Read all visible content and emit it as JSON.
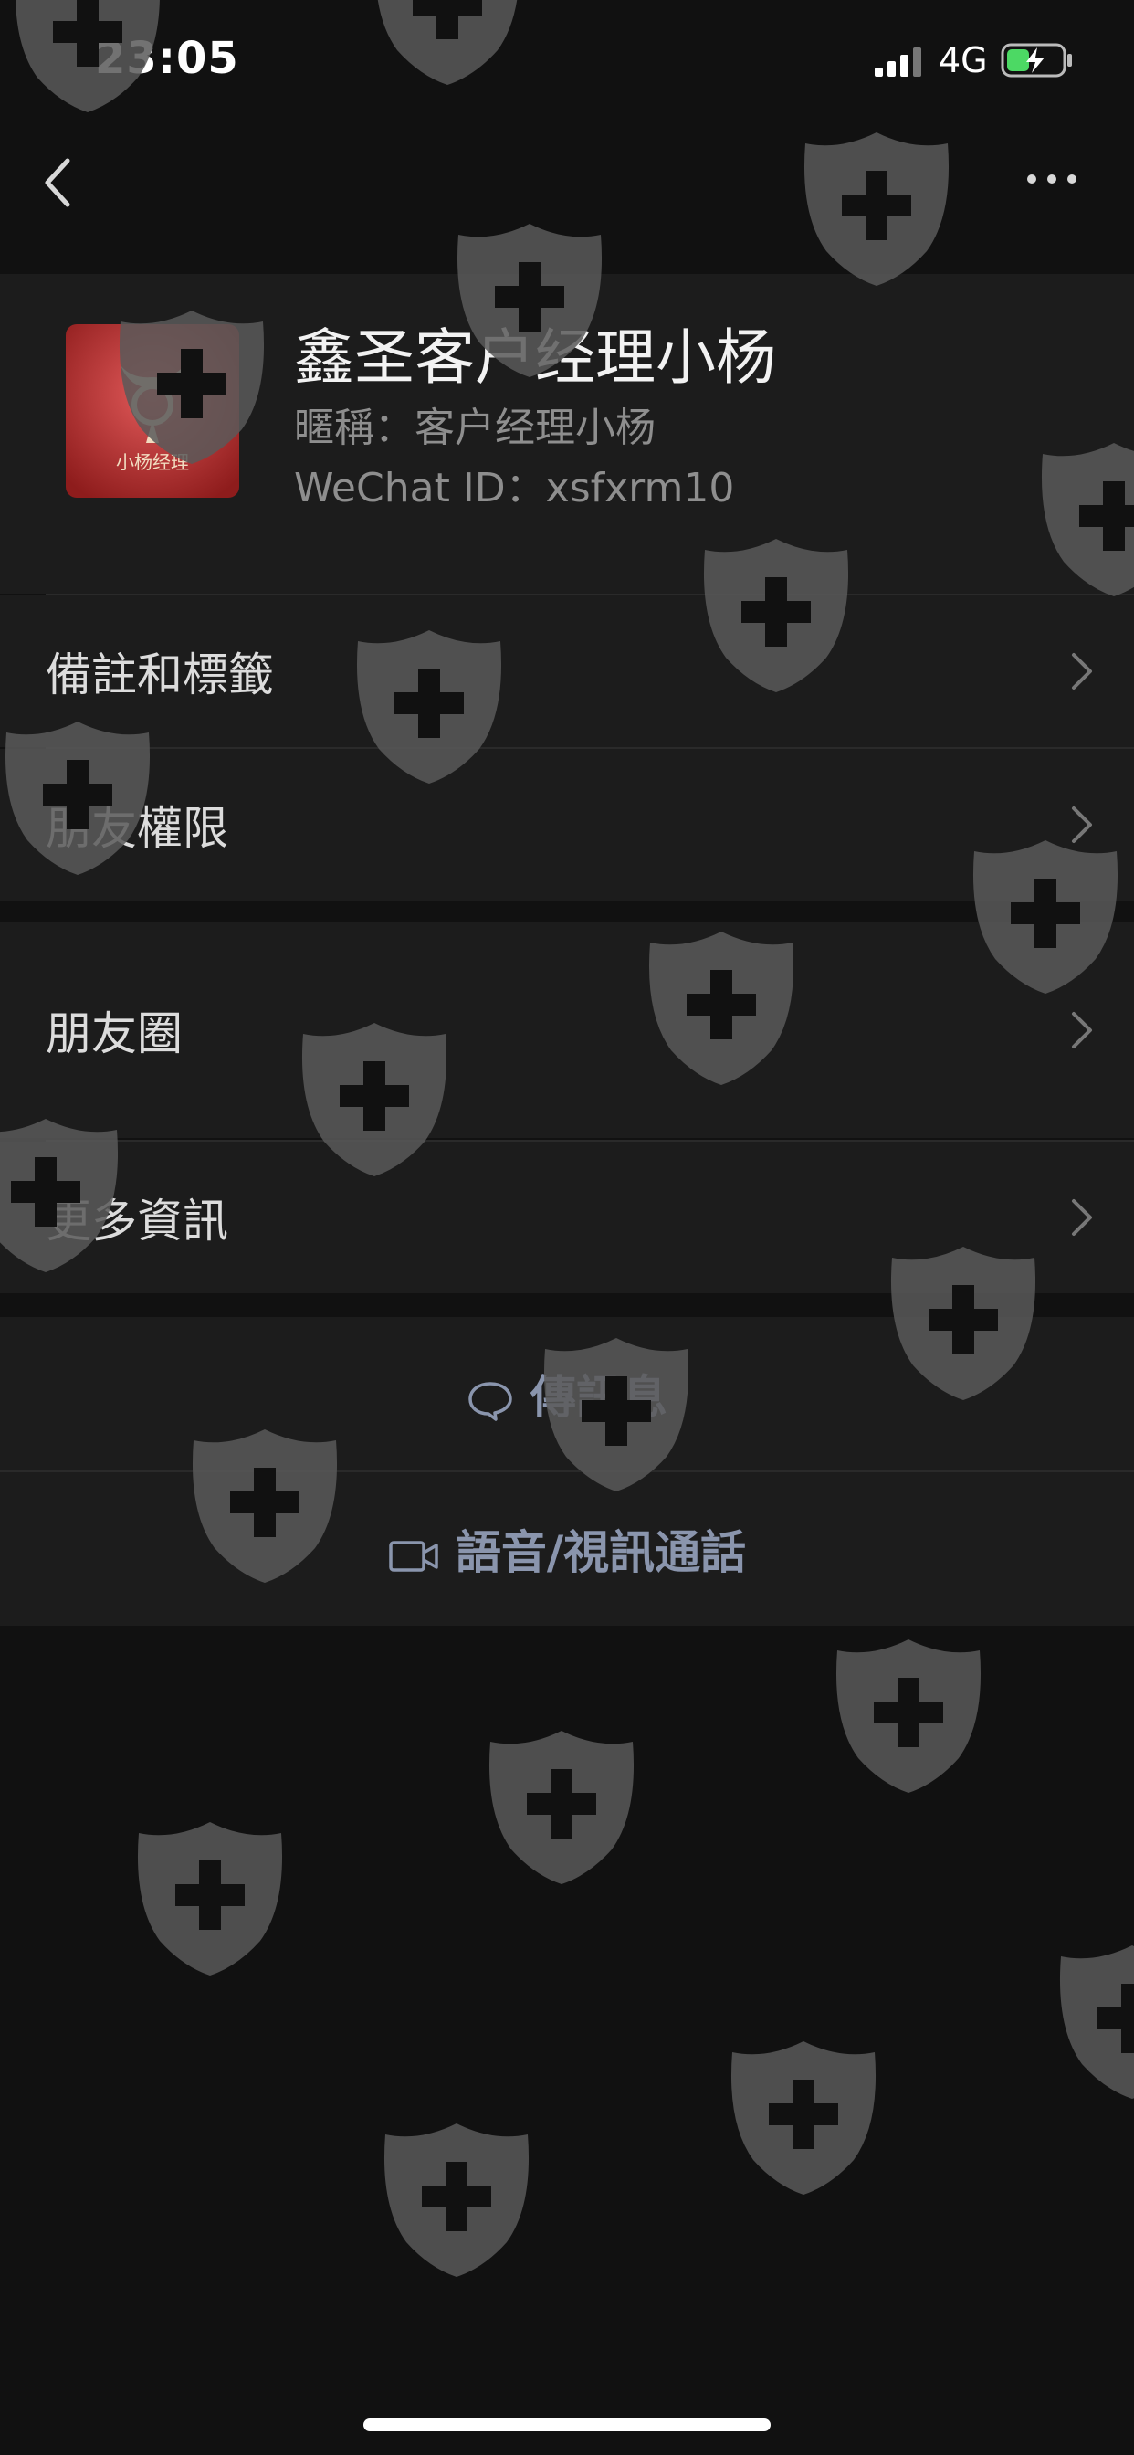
{
  "status_bar": {
    "time": "23:05",
    "network": "4G"
  },
  "nav": {
    "back_icon": "chevron-left",
    "more_icon": "ellipsis-horizontal"
  },
  "profile": {
    "name": "鑫圣客户经理小杨",
    "nickname": "暱稱：客户经理小杨",
    "wechat_id": "WeChat ID：xsfxrm10",
    "avatar_text": "小杨经理"
  },
  "menu_group_1": [
    {
      "label": "備註和標籤"
    },
    {
      "label": "朋友權限"
    }
  ],
  "menu_group_2": [
    {
      "label": "朋友圈"
    },
    {
      "label": "更多資訊"
    }
  ],
  "actions": {
    "message_label": "傳訊息",
    "call_label": "語音/視訊通話"
  },
  "colors": {
    "background": "#111111",
    "cell": "#1c1c1c",
    "action_text": "#8a95ad",
    "watermark": "#5a5a5a"
  }
}
